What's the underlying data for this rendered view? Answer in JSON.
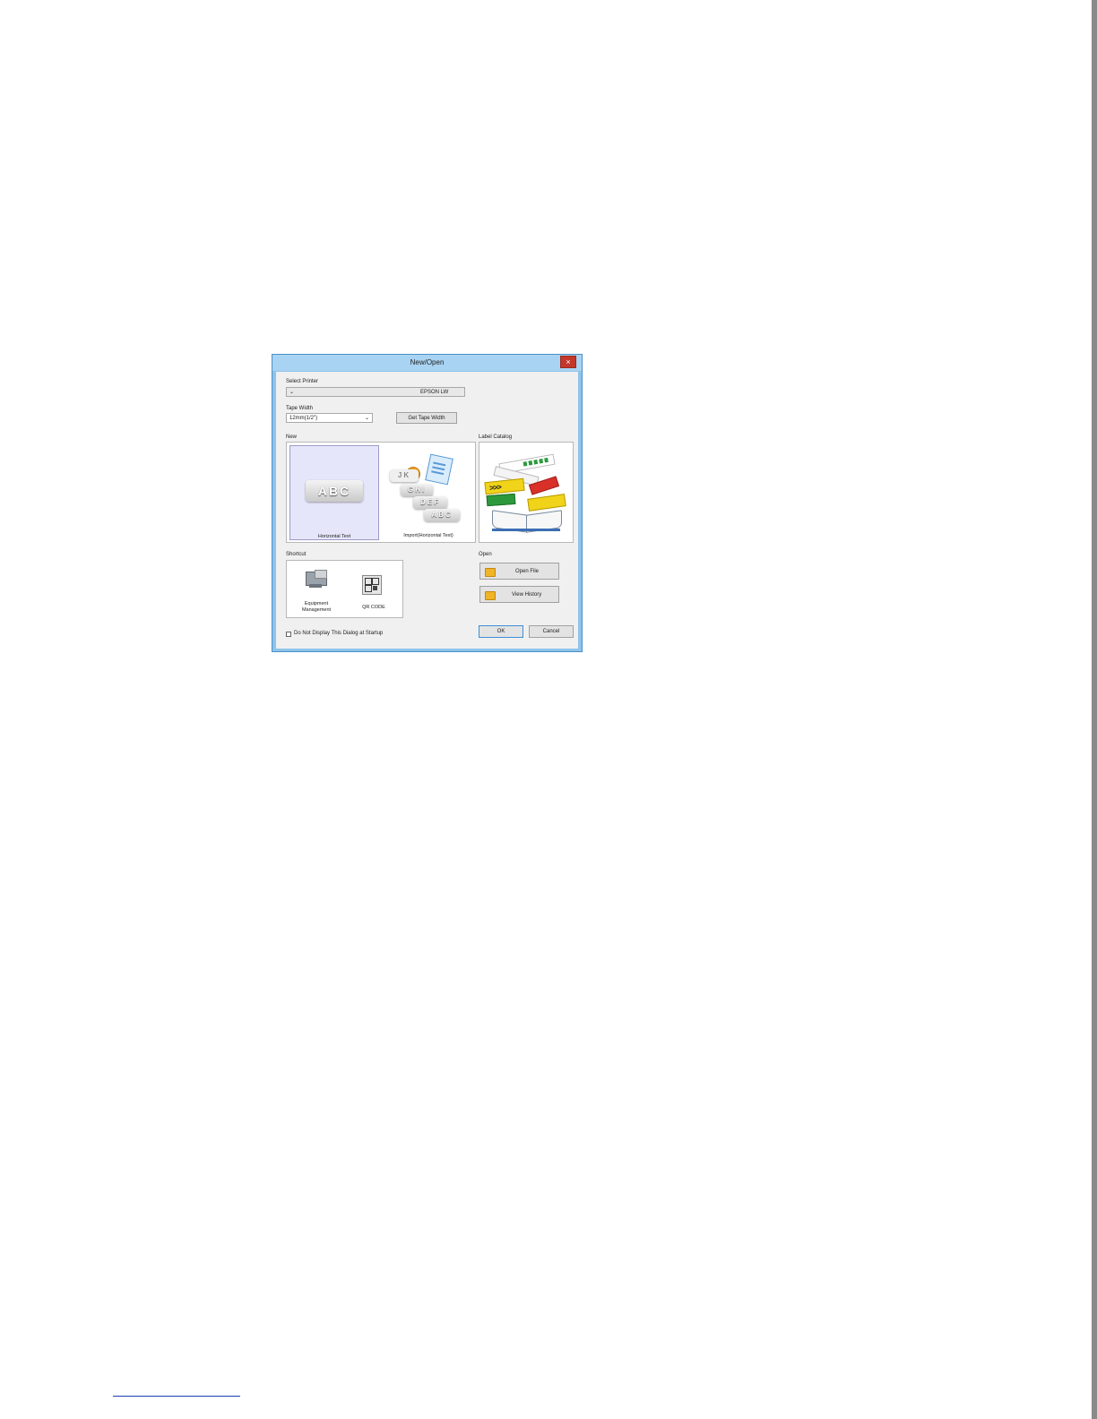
{
  "dialog": {
    "title": "New/Open",
    "close_symbol": "×",
    "select_printer": {
      "label": "Select Printer",
      "value": "EPSON LW"
    },
    "tape_width": {
      "label": "Tape Width",
      "value": "12mm(1/2\")",
      "get_button": "Get Tape Width"
    },
    "new_section": {
      "label": "New",
      "tiles": [
        {
          "caption": "Horizontal Text",
          "art_text": "ABC",
          "selected": true
        },
        {
          "caption": "Import(Horizontal Text)",
          "art_lines": [
            "JK",
            "GHI",
            "DEF",
            "ABC"
          ]
        }
      ]
    },
    "label_catalog": {
      "label": "Label Catalog"
    },
    "shortcut": {
      "label": "Shortcut",
      "items": [
        {
          "caption_line1": "Equipment",
          "caption_line2": "Management",
          "icon": "equipment-management-icon"
        },
        {
          "caption": "QR CODE",
          "icon": "qr-code-icon"
        }
      ]
    },
    "open": {
      "label": "Open",
      "open_file": "Open File",
      "view_history": "View History"
    },
    "startup_checkbox": {
      "label": "Do Not Display This Dialog at Startup",
      "checked": false
    },
    "ok_label": "OK",
    "cancel_label": "Cancel"
  },
  "colors": {
    "frame": "#8fc3ea",
    "titlebar": "#a9d3f2",
    "close": "#c4372b",
    "selected_tile": "#e6e6fa",
    "link_rule": "#1a3fb0"
  }
}
